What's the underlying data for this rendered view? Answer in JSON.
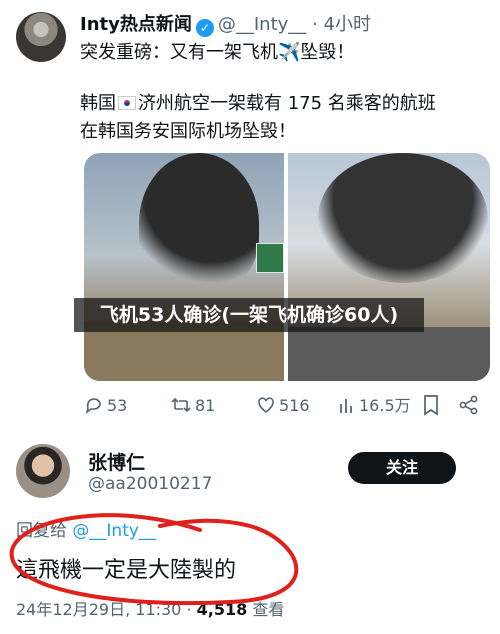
{
  "tweet": {
    "display_name": "Inty热点新闻",
    "handle": "@__Inty__",
    "separator": "·",
    "time_ago": "4小时",
    "headline": "突发重磅：又有一架飞机✈️坠毁！",
    "body_line1_pre": "韩国",
    "body_line1_post": "济州航空一架载有 175 名乘客的航班",
    "body_line2": "在韩国务安国际机场坠毁！",
    "overlay_caption": "飞机53人确诊(一架飞机确诊60人)",
    "stats": {
      "replies": "53",
      "retweets": "81",
      "likes": "516",
      "views": "16.5万"
    }
  },
  "reply": {
    "display_name": "张博仁",
    "handle": "@aa20010217",
    "follow_label": "关注",
    "reply_prefix": "回复给",
    "reply_target": "@__Inty__",
    "text": "這飛機一定是大陸製的",
    "date": "24年12月29日, 11:30 · ",
    "views_count": "4,518",
    "views_label": " 查看"
  },
  "colors": {
    "accent": "#1d9bf0",
    "muted": "#536471",
    "annotation": "#e0201b"
  }
}
